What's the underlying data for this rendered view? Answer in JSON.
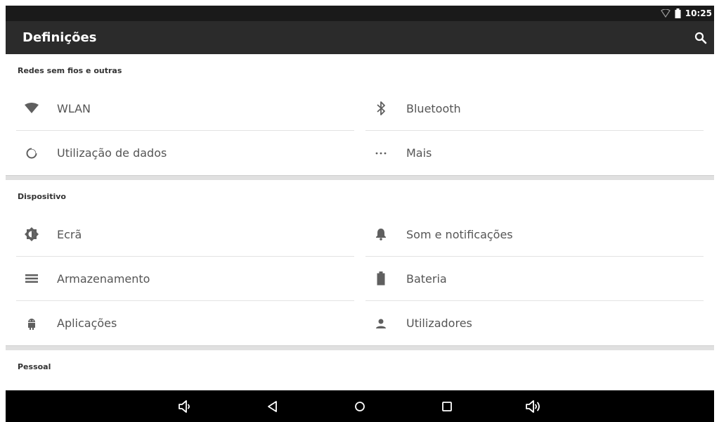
{
  "status_bar": {
    "time": "10:25",
    "icons": [
      "wifi-icon",
      "battery-icon"
    ]
  },
  "app_bar": {
    "title": "Definições",
    "search_icon": "search-icon"
  },
  "sections": {
    "wireless": {
      "header": "Redes sem fios e outras",
      "items": {
        "wlan": {
          "label": "WLAN",
          "icon": "wifi-icon"
        },
        "bluetooth": {
          "label": "Bluetooth",
          "icon": "bluetooth-icon"
        },
        "data_usage": {
          "label": "Utilização de dados",
          "icon": "data-usage-icon"
        },
        "more": {
          "label": "Mais",
          "icon": "more-icon"
        }
      }
    },
    "device": {
      "header": "Dispositivo",
      "items": {
        "display": {
          "label": "Ecrã",
          "icon": "brightness-icon"
        },
        "sound": {
          "label": "Som e notificações",
          "icon": "bell-icon"
        },
        "storage": {
          "label": "Armazenamento",
          "icon": "storage-icon"
        },
        "battery": {
          "label": "Bateria",
          "icon": "battery-icon"
        },
        "apps": {
          "label": "Aplicações",
          "icon": "android-icon"
        },
        "users": {
          "label": "Utilizadores",
          "icon": "user-icon"
        }
      }
    },
    "personal": {
      "header": "Pessoal"
    }
  },
  "nav_bar": {
    "buttons": [
      "volume-down-icon",
      "back-icon",
      "home-icon",
      "recents-icon",
      "volume-up-icon"
    ]
  },
  "colors": {
    "status_bar": "#1a1a1a",
    "app_bar": "#2b2b2b",
    "nav_bar": "#000000",
    "icon": "#5f5f5f"
  }
}
